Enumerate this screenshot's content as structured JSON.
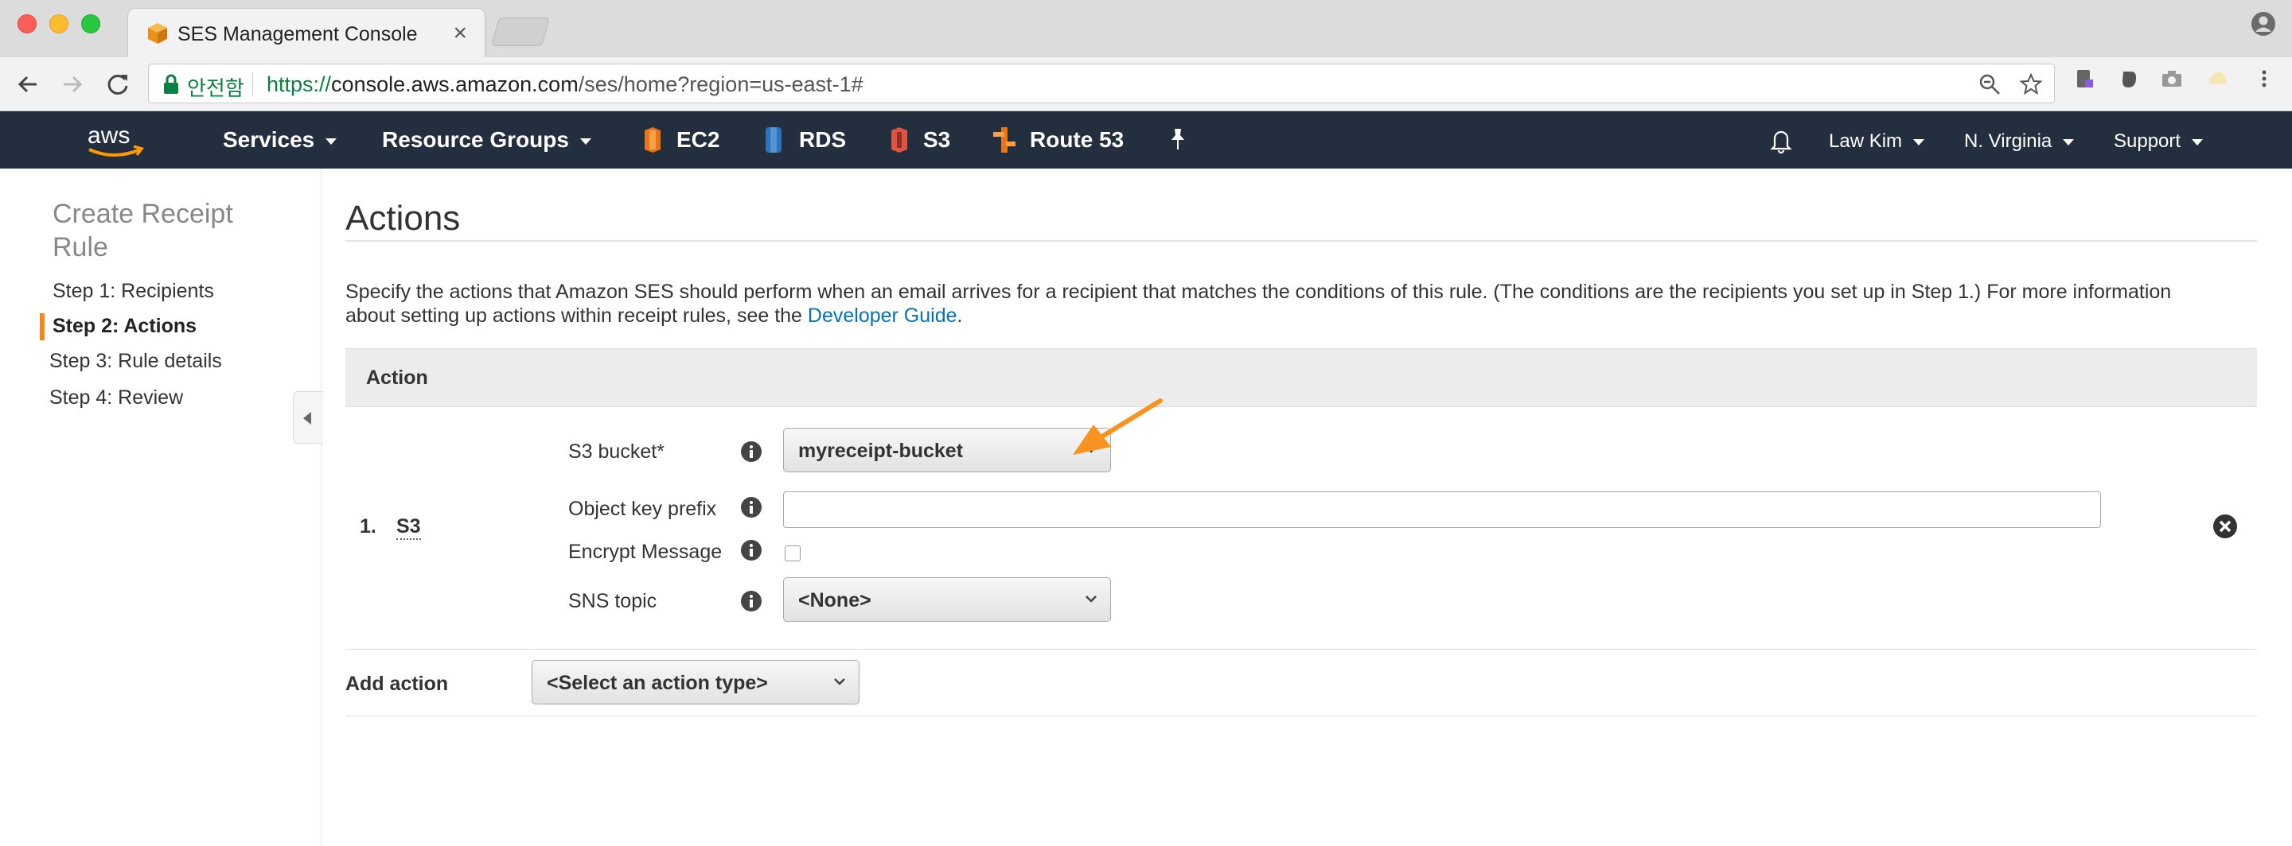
{
  "browser": {
    "tab_title": "SES Management Console",
    "close_glyph": "×",
    "secure_label": "안전함",
    "url_scheme": "https://",
    "url_host": "console.aws.amazon.com",
    "url_path": "/ses/home?region=us-east-1#"
  },
  "aws_nav": {
    "logo": "aws",
    "services": "Services",
    "resource_groups": "Resource Groups",
    "shortcuts": [
      "EC2",
      "RDS",
      "S3",
      "Route 53"
    ],
    "user": "Law Kim",
    "region": "N. Virginia",
    "support": "Support"
  },
  "sidebar": {
    "title": "Create Receipt Rule",
    "steps": [
      "Step 1: Recipients",
      "Step 2: Actions",
      "Step 3: Rule details",
      "Step 4: Review"
    ],
    "active_step": 1
  },
  "main": {
    "title": "Actions",
    "description_line1": "Specify the actions that Amazon SES should perform when an email arrives for a recipient that matches the conditions of this rule. (The conditions are the recipients you set up in Step 1.) For more information",
    "description_line2": "about setting up actions within receipt rules, see the ",
    "developer_guide_link": "Developer Guide",
    "description_end": ".",
    "action_header": "Action",
    "action": {
      "number": "1.",
      "type": "S3",
      "s3_bucket_label": "S3 bucket*",
      "s3_bucket_value": "myreceipt-bucket",
      "object_key_prefix_label": "Object key prefix",
      "object_key_prefix_value": "",
      "encrypt_label": "Encrypt Message",
      "encrypt_checked": false,
      "sns_topic_label": "SNS topic",
      "sns_topic_value": "<None>"
    },
    "add_action_label": "Add action",
    "add_action_select": "<Select an action type>"
  },
  "colors": {
    "aws_nav_bg": "#232f3e",
    "active_marker": "#f0891d",
    "link": "#0073bb",
    "secure": "#0b8043"
  }
}
